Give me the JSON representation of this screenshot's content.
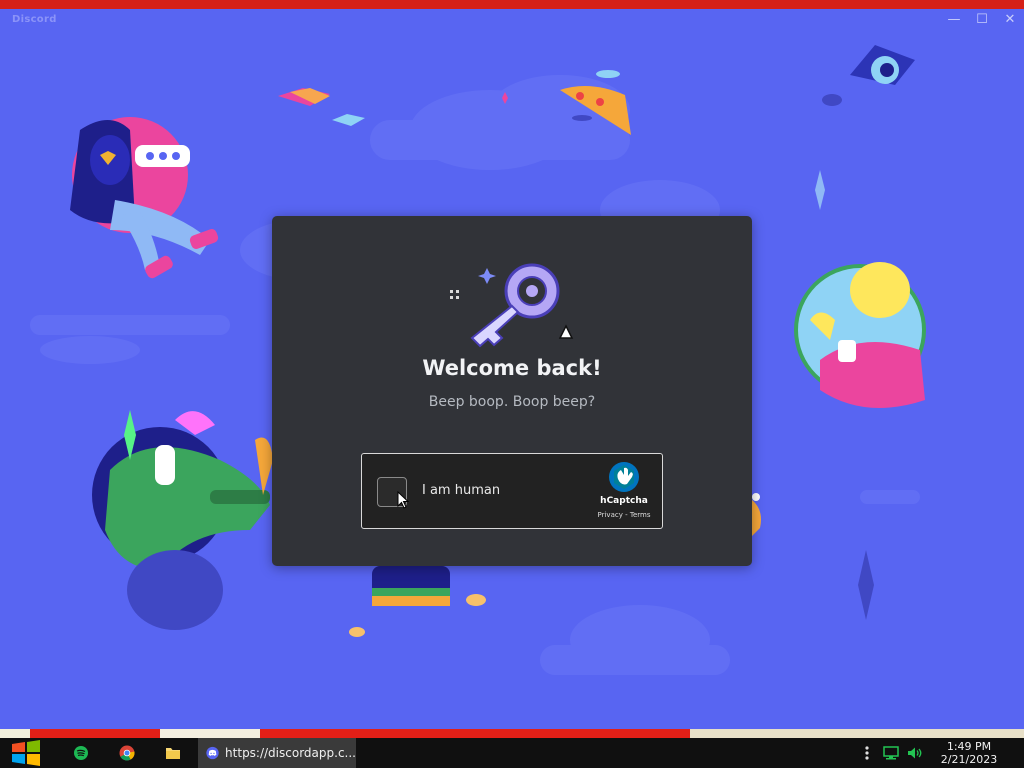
{
  "window": {
    "app_name": "Discord",
    "minimize_glyph": "—",
    "maximize_glyph": "☐",
    "close_glyph": "✕"
  },
  "login": {
    "title": "Welcome back!",
    "subtitle": "Beep boop. Boop beep?"
  },
  "captcha": {
    "label": "I am human",
    "brand": "hCaptcha",
    "privacy": "Privacy",
    "separator": " - ",
    "terms": "Terms"
  },
  "taskbar": {
    "active_task": "https://discordapp.c...",
    "time": "1:49 PM",
    "date": "2/21/2023",
    "pinned": [
      "start-icon",
      "spotify-icon",
      "chrome-icon",
      "file-explorer-icon"
    ],
    "tray": [
      "more-icon",
      "network-icon",
      "volume-icon"
    ]
  },
  "colors": {
    "blurple": "#5865f2",
    "modal_bg": "#313338",
    "taskbar_bg": "#101010"
  }
}
